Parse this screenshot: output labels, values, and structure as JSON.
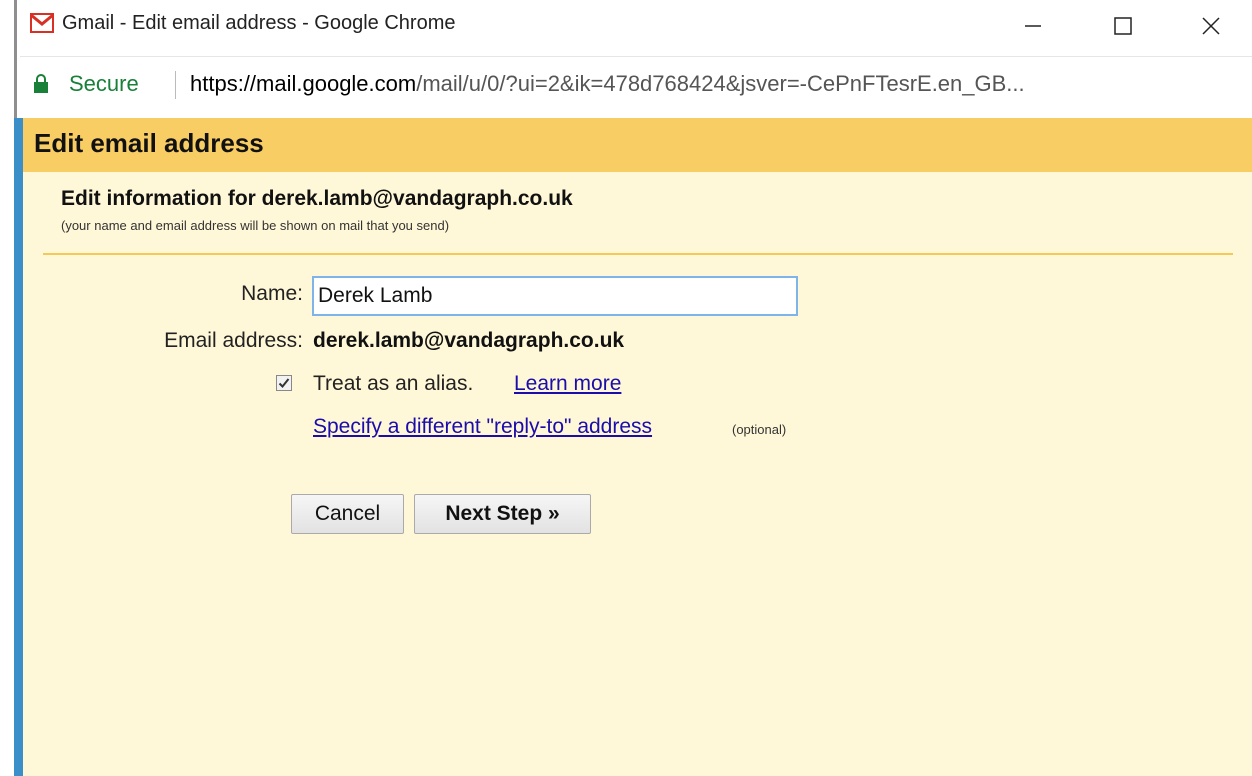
{
  "window": {
    "title": "Gmail - Edit email address - Google Chrome",
    "minimize_icon": "minimize-icon",
    "maximize_icon": "maximize-icon",
    "close_icon": "close-icon"
  },
  "address_bar": {
    "secure_label": "Secure",
    "url_host": "https://mail.google.com",
    "url_rest": "/mail/u/0/?ui=2&ik=478d768424&jsver=-CePnFTesrE.en_GB..."
  },
  "dialog": {
    "title": "Edit email address",
    "info_title": "Edit information for derek.lamb@vandagraph.co.uk",
    "info_subtitle": "(your name and email address will be shown on mail that you send)",
    "name_label": "Name:",
    "name_value": "Derek Lamb",
    "email_label": "Email address:",
    "email_value": "derek.lamb@vandagraph.co.uk",
    "alias_checked": true,
    "alias_text": "Treat as an alias.",
    "learn_more": "Learn more",
    "replyto_link": "Specify a different \"reply-to\" address",
    "optional": "(optional)",
    "cancel_button": "Cancel",
    "next_button": "Next Step »"
  },
  "colors": {
    "header_bg": "#f8cd64",
    "dialog_bg": "#fff8d8",
    "link": "#1a0dab",
    "secure": "#188038",
    "input_border": "#7eb4ea"
  }
}
